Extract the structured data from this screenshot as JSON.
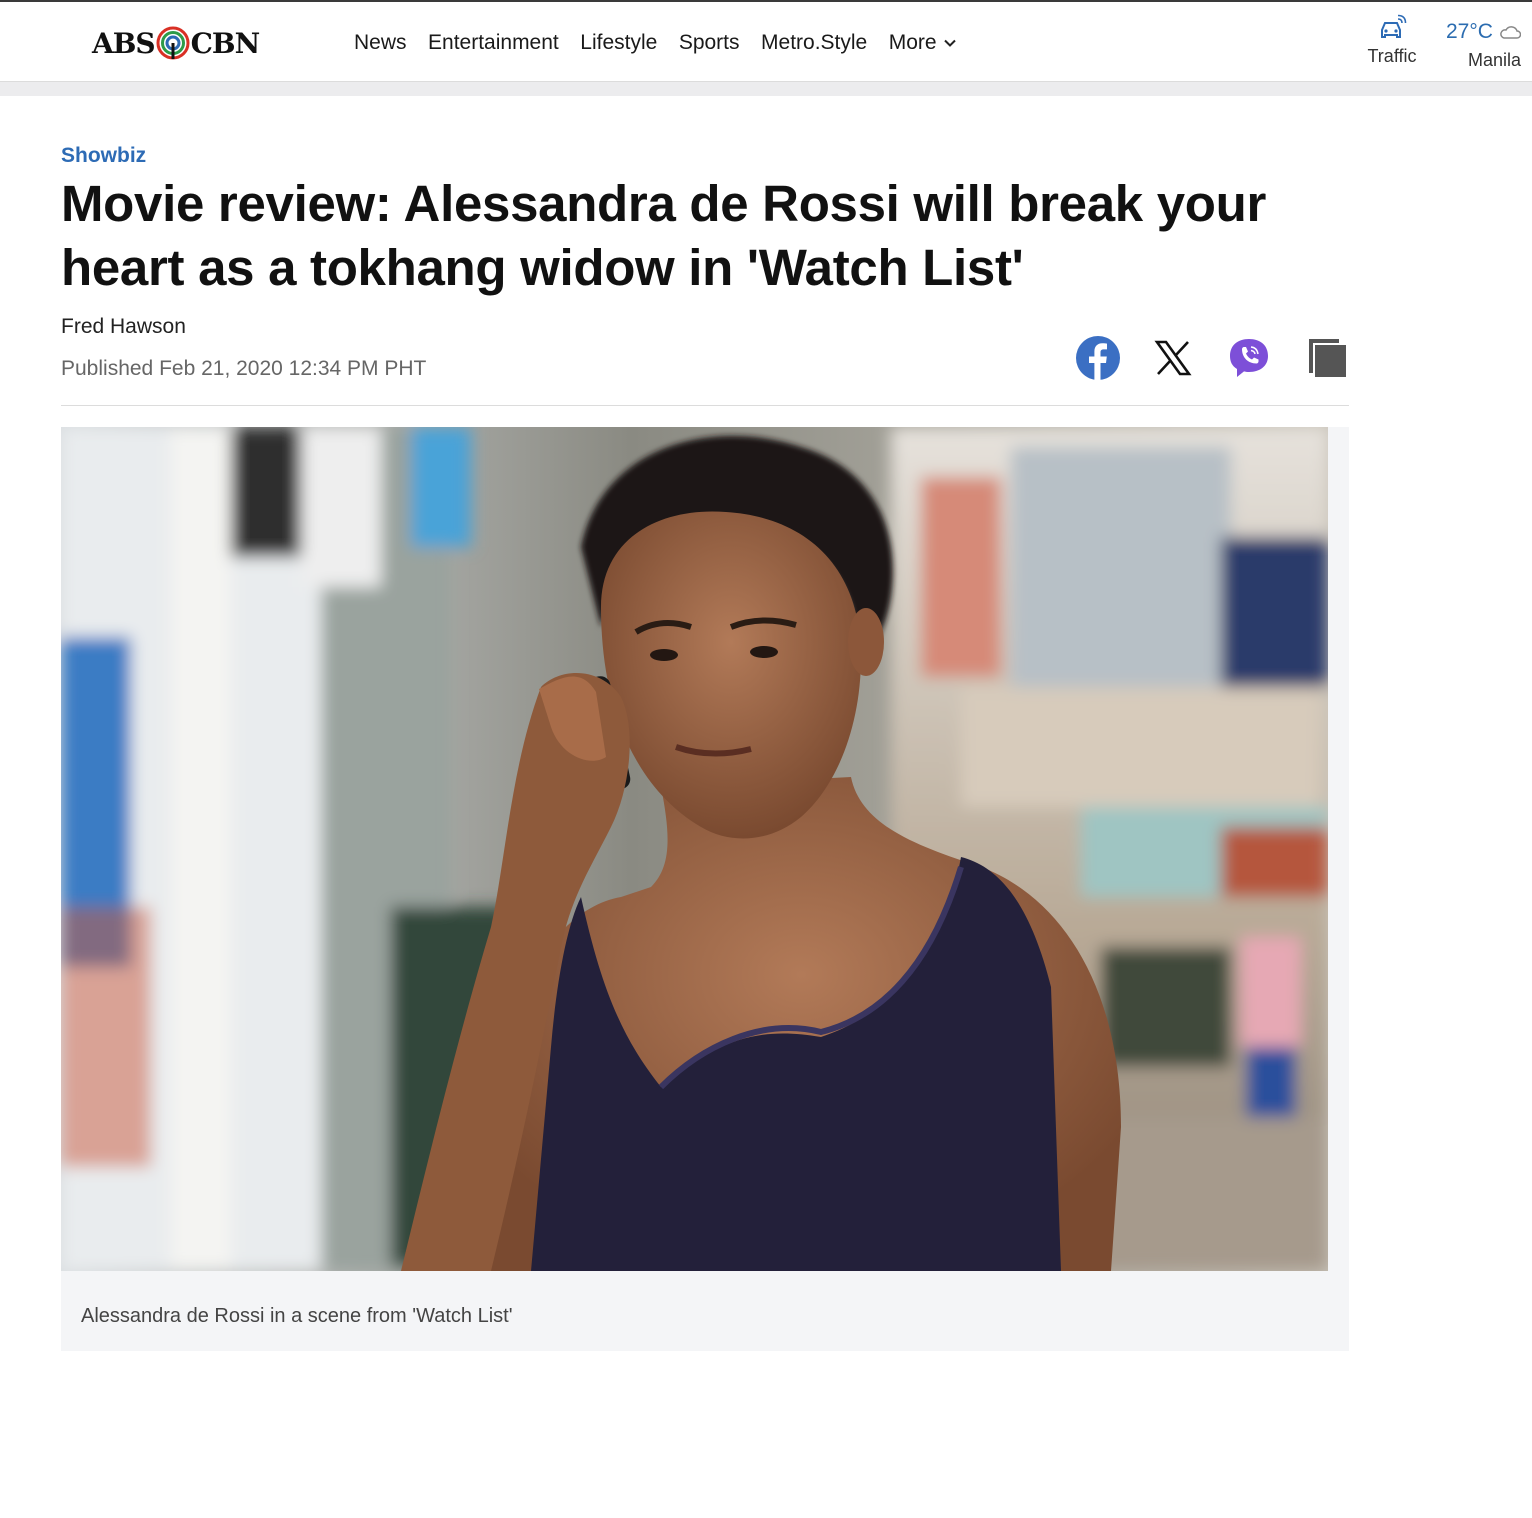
{
  "brand": {
    "logo_left": "ABS",
    "logo_right": "CBN",
    "accent": "#2d6bb5"
  },
  "nav": {
    "items": [
      "News",
      "Entertainment",
      "Lifestyle",
      "Sports",
      "Metro.Style"
    ],
    "more_label": "More"
  },
  "utility": {
    "traffic_label": "Traffic",
    "weather_temp": "27°C",
    "weather_city": "Manila"
  },
  "article": {
    "category": "Showbiz",
    "headline": "Movie review: Alessandra de Rossi will break your heart as a tokhang widow in 'Watch List'",
    "author": "Fred Hawson",
    "published": "Published Feb 21, 2020 12:34 PM PHT",
    "caption": "Alessandra de Rossi in a scene from 'Watch List'"
  },
  "share": {
    "icons": [
      "facebook-icon",
      "x-icon",
      "viber-icon",
      "copy-link-icon"
    ],
    "colors": {
      "facebook": "#3b6fc3",
      "viber": "#7d4fd8",
      "copy": "#555555"
    }
  }
}
